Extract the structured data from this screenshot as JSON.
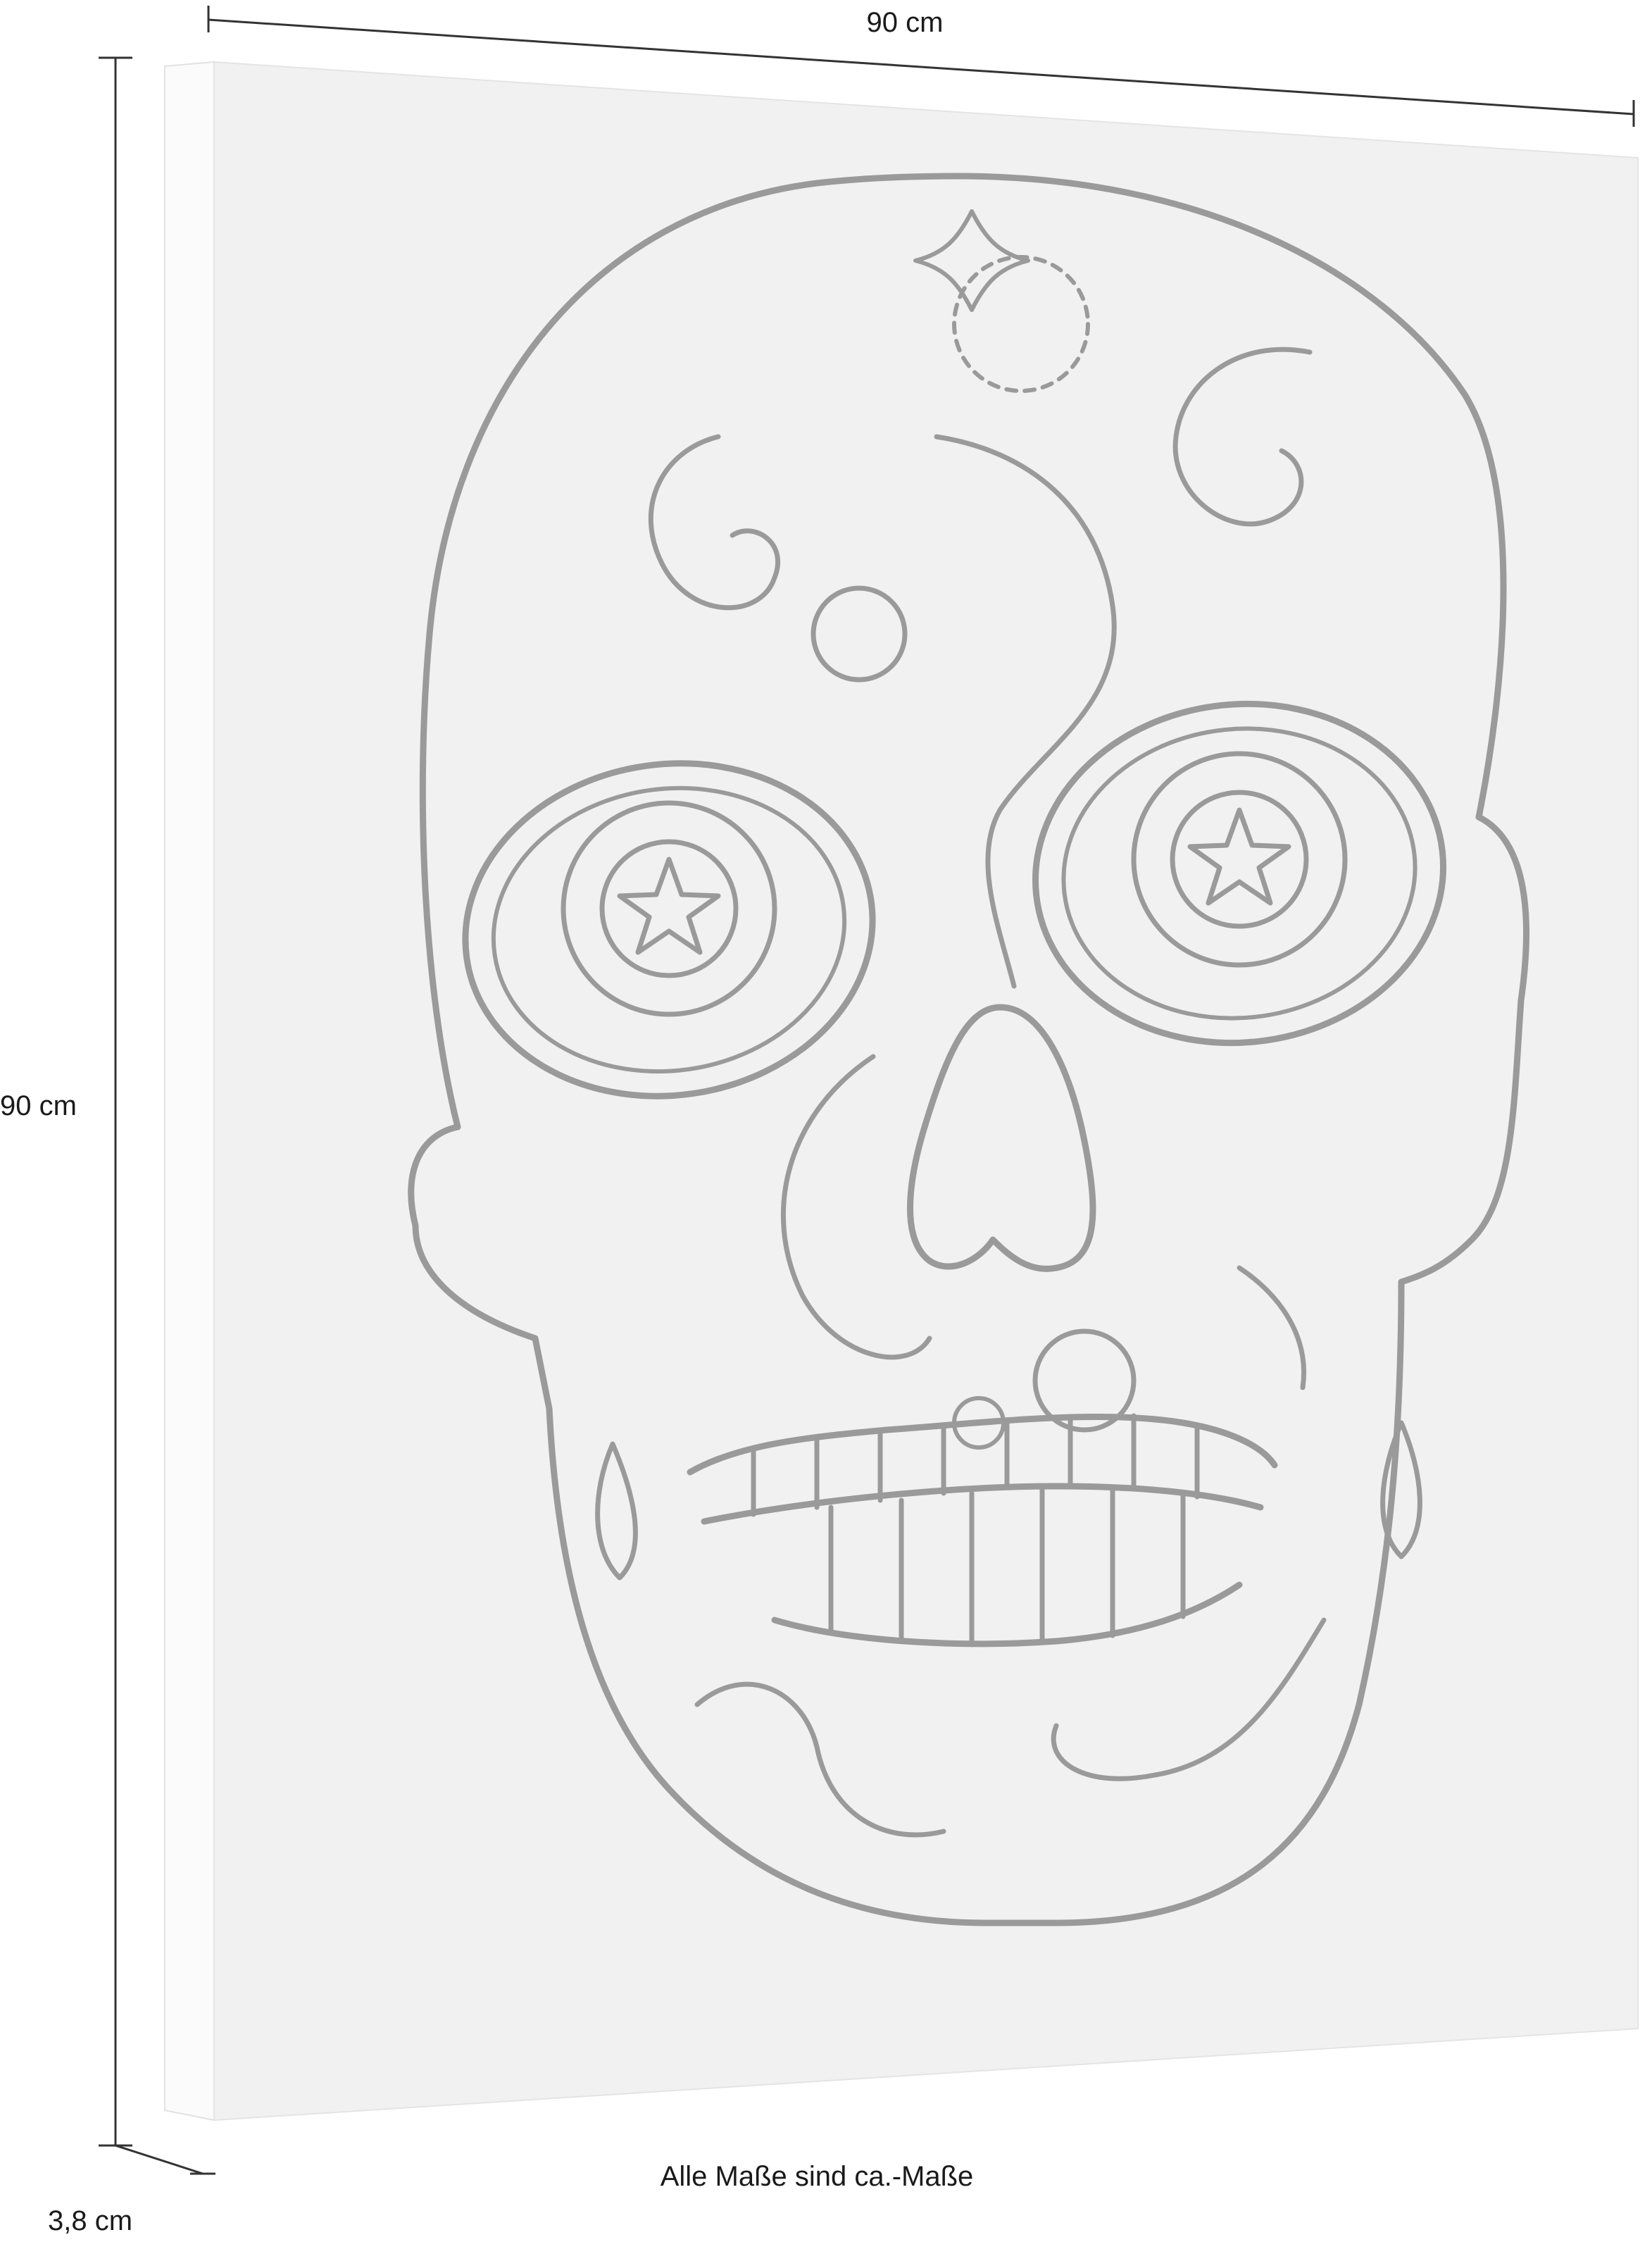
{
  "dimensions": {
    "width": "90 cm",
    "height": "90 cm",
    "depth": "3,8 cm"
  },
  "footnote": "Alle Maße sind ca.-Maße",
  "product_image": {
    "subject": "sugar-skull",
    "colors": {
      "canvas": "#f1f1f1",
      "canvas_edge": "#fbfbfb",
      "line_art": "#9a9a9a",
      "dimension_line": "#333333"
    }
  }
}
